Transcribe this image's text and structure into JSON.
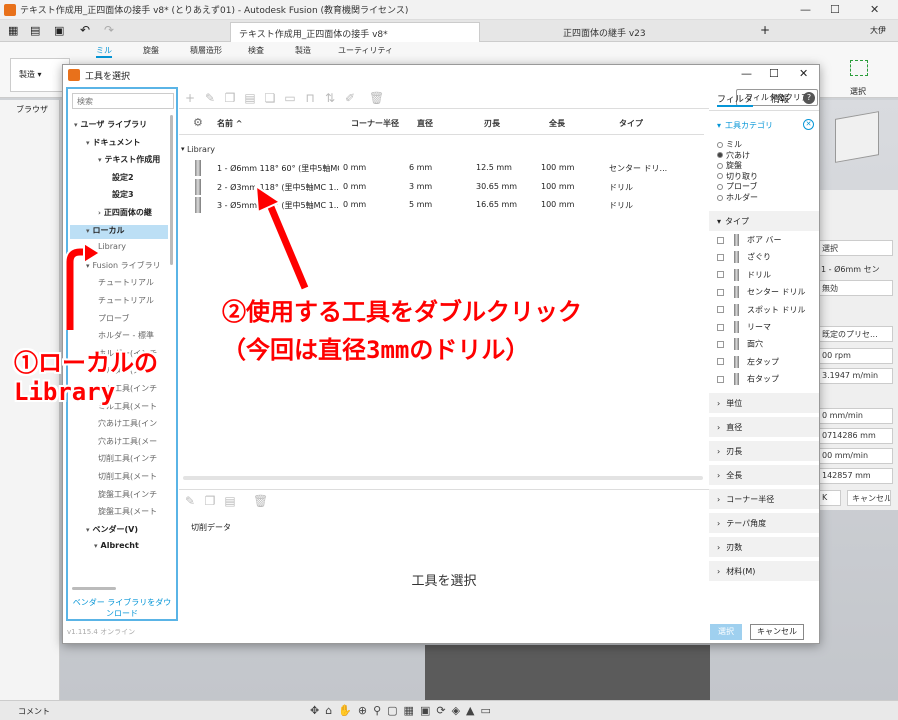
{
  "app": {
    "title": "テキスト作成用_正四面体の接手 v8* (とりあえず01) - Autodesk Fusion (教育機関ライセンス)",
    "tabs": [
      {
        "label": "テキスト作成用_正四面体の接手 v8*"
      },
      {
        "label": "正四面体の継手 v23"
      }
    ],
    "ribbon_tabs": [
      "ミル",
      "旋盤",
      "積層造形",
      "検査",
      "製造",
      "ユーティリティ"
    ],
    "workspace": "製造",
    "select_label": "選択",
    "browser_label": "ブラウザ",
    "comment_label": "コメント",
    "user_initials": "大伊"
  },
  "right_panel": {
    "items": [
      "選択",
      "1 - Ø6mm セン",
      "無効",
      "既定のプリセ...",
      "00 rpm",
      "3.1947 m/min",
      "0 mm/min",
      "0714286 mm",
      "00 mm/min",
      "142857 mm",
      "K",
      "キャンセル"
    ]
  },
  "dialog": {
    "title": "工具を選択",
    "search_placeholder": "検索",
    "filter_clear": "フィルタをクリア",
    "tree": [
      {
        "label": "ユーザ ライブラリ",
        "arrow": "▾",
        "style": "bold"
      },
      {
        "label": "ドキュメント",
        "arrow": "▾",
        "style": "bold"
      },
      {
        "label": "テキスト作成用",
        "arrow": "▾",
        "style": "bold"
      },
      {
        "label": "設定2",
        "arrow": "",
        "style": "bold"
      },
      {
        "label": "設定3",
        "arrow": "",
        "style": "bold"
      },
      {
        "label": "正四面体の継",
        "arrow": "›",
        "style": "bold"
      },
      {
        "label": "ローカル",
        "arrow": "▾",
        "style": "bold sel"
      },
      {
        "label": "Library",
        "arrow": "",
        "style": "dim"
      },
      {
        "label": "Fusion ライブラリ",
        "arrow": "▾",
        "style": "dim"
      },
      {
        "label": "チュートリアル",
        "arrow": "",
        "style": "dim"
      },
      {
        "label": "チュートリアル",
        "arrow": "",
        "style": "dim"
      },
      {
        "label": "プローブ",
        "arrow": "",
        "style": "dim"
      },
      {
        "label": "ホルダー - 標準",
        "arrow": "",
        "style": "dim"
      },
      {
        "label": "ホルダー(インチ",
        "arrow": "",
        "style": "dim"
      },
      {
        "label": "ホルダー(メート",
        "arrow": "",
        "style": "dim"
      },
      {
        "label": "ミル工具(インチ",
        "arrow": "",
        "style": "dim"
      },
      {
        "label": "ミル工具(メート",
        "arrow": "",
        "style": "dim"
      },
      {
        "label": "穴あけ工具(イン",
        "arrow": "",
        "style": "dim"
      },
      {
        "label": "穴あけ工具(メー",
        "arrow": "",
        "style": "dim"
      },
      {
        "label": "切削工具(インチ",
        "arrow": "",
        "style": "dim"
      },
      {
        "label": "切削工具(メート",
        "arrow": "",
        "style": "dim"
      },
      {
        "label": "旋盤工具(インチ",
        "arrow": "",
        "style": "dim"
      },
      {
        "label": "旋盤工具(メート",
        "arrow": "",
        "style": "dim"
      },
      {
        "label": "ベンダー(V)",
        "arrow": "▾",
        "style": "bold"
      },
      {
        "label": "Albrecht",
        "arrow": "▾",
        "style": "bold"
      }
    ],
    "vendor_link": "ベンダー ライブラリをダウンロード",
    "version": "v1.115.4 オンライン",
    "columns": [
      "名前 ^",
      "コーナー半径",
      "直径",
      "刃長",
      "全長",
      "タイプ"
    ],
    "group": "Library",
    "rows": [
      {
        "name": "1 - Ø6mm 118° 60° (里中5軸MC...",
        "corner": "0 mm",
        "diameter": "6 mm",
        "flute": "12.5 mm",
        "overall": "100 mm",
        "type": "センター ドリ..."
      },
      {
        "name": "2 - Ø3mm 118° (里中5軸MC 1...",
        "corner": "0 mm",
        "diameter": "3 mm",
        "flute": "30.65 mm",
        "overall": "100 mm",
        "type": "ドリル"
      },
      {
        "name": "3 - Ø5mm 118° (里中5軸MC 1...",
        "corner": "0 mm",
        "diameter": "5 mm",
        "flute": "16.65 mm",
        "overall": "100 mm",
        "type": "ドリル"
      }
    ],
    "cut_data_label": "切削データ",
    "empty_label": "工具を選択",
    "filter_tab": "フィルタ",
    "info_tab": "情報",
    "filter": {
      "category_title": "工具カテゴリ",
      "categories": [
        {
          "label": "ミル",
          "on": false
        },
        {
          "label": "穴あけ",
          "on": true
        },
        {
          "label": "旋盤",
          "on": false
        },
        {
          "label": "切り取り",
          "on": false
        },
        {
          "label": "プローブ",
          "on": false
        },
        {
          "label": "ホルダー",
          "on": false
        }
      ],
      "type_title": "タイプ",
      "types": [
        "ボア バー",
        "ざぐり",
        "ドリル",
        "センター ドリル",
        "スポット ドリル",
        "リーマ",
        "面穴",
        "左タップ",
        "右タップ"
      ],
      "sections": [
        "単位",
        "直径",
        "刃長",
        "全長",
        "コーナー半径",
        "テーパ角度",
        "刃数",
        "材料(M)"
      ]
    },
    "select_button": "選択",
    "cancel_button": "キャンセル"
  },
  "annotations": {
    "local_library": [
      "①ローカルの",
      "Library"
    ],
    "double_click": [
      "②使用する工具をダブルクリック",
      "（今回は直径3mmのドリル）"
    ]
  },
  "colors": {
    "accent": "#0696d7",
    "annotation": "#ff0000"
  }
}
